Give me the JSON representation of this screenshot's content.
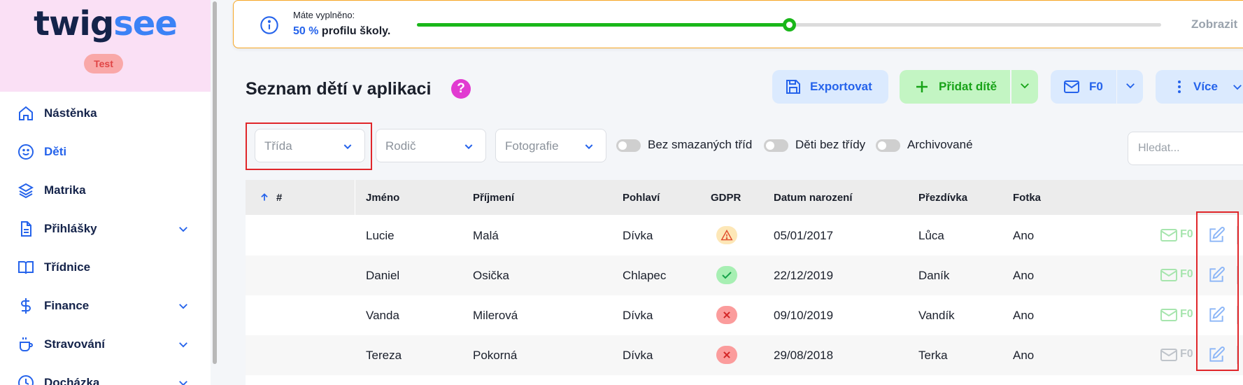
{
  "brand": {
    "logo_part1": "twig",
    "logo_part2": "see",
    "env_badge": "Test"
  },
  "sidebar": {
    "items": [
      {
        "label": "Nástěnka",
        "icon": "home-icon",
        "has_chevron": false,
        "active": false
      },
      {
        "label": "Děti",
        "icon": "smile-icon",
        "has_chevron": false,
        "active": true
      },
      {
        "label": "Matrika",
        "icon": "layers-icon",
        "has_chevron": false,
        "active": false
      },
      {
        "label": "Přihlášky",
        "icon": "document-icon",
        "has_chevron": true,
        "active": false
      },
      {
        "label": "Třídnice",
        "icon": "book-icon",
        "has_chevron": false,
        "active": false
      },
      {
        "label": "Finance",
        "icon": "dollar-icon",
        "has_chevron": true,
        "active": false
      },
      {
        "label": "Stravování",
        "icon": "cup-icon",
        "has_chevron": true,
        "active": false
      },
      {
        "label": "Docházka",
        "icon": "clock-icon",
        "has_chevron": true,
        "active": false
      }
    ]
  },
  "banner": {
    "line1": "Máte vyplněno:",
    "percent": "50 %",
    "line2_rest": " profilu školy.",
    "progress_fraction": 0.5,
    "show_label": "Zobrazit"
  },
  "header": {
    "title": "Seznam dětí v aplikaci",
    "help": "?"
  },
  "toolbar": {
    "export_label": "Exportovat",
    "add_label": "Přidat dítě",
    "mail_label": "F0",
    "more_label": "Více"
  },
  "filters": {
    "class_placeholder": "Třída",
    "parent_placeholder": "Rodič",
    "photo_placeholder": "Fotografie",
    "toggle_no_deleted": "Bez smazaných tříd",
    "toggle_no_class": "Děti bez třídy",
    "toggle_archived": "Archivované",
    "search_placeholder": "Hledat..."
  },
  "table": {
    "columns": [
      "#",
      "Jméno",
      "Příjmení",
      "Pohlaví",
      "GDPR",
      "Datum narození",
      "Přezdívka",
      "Fotka"
    ],
    "rows": [
      {
        "first": "Lucie",
        "last": "Malá",
        "gender": "Dívka",
        "gdpr": "warning",
        "dob": "05/01/2017",
        "nick": "Lůca",
        "photo": "Ano",
        "mail": "F0"
      },
      {
        "first": "Daniel",
        "last": "Osička",
        "gender": "Chlapec",
        "gdpr": "ok",
        "dob": "22/12/2019",
        "nick": "Daník",
        "photo": "Ano",
        "mail": "F0"
      },
      {
        "first": "Vanda",
        "last": "Milerová",
        "gender": "Dívka",
        "gdpr": "denied",
        "dob": "09/10/2019",
        "nick": "Vandík",
        "photo": "Ano",
        "mail": "F0"
      },
      {
        "first": "Tereza",
        "last": "Pokorná",
        "gender": "Dívka",
        "gdpr": "denied",
        "dob": "29/08/2018",
        "nick": "Terka",
        "photo": "Ano",
        "mail": "F0"
      }
    ]
  },
  "colors": {
    "accent": "#2563eb",
    "brand_bg": "#fae0f5",
    "success": "#1ab71a",
    "highlight": "#e0262a"
  }
}
